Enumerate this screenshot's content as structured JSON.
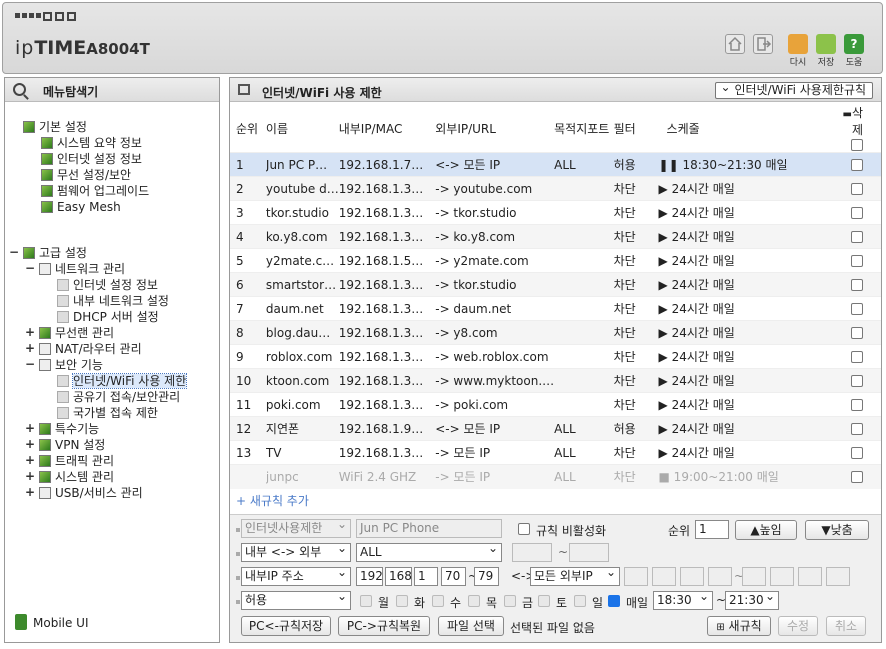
{
  "brand": {
    "logo_prefix": "ip",
    "logo_bold": "TIME",
    "model": "A8004T"
  },
  "top_actions": [
    {
      "label": "다시",
      "color": "#e8a33a",
      "icon": "logout-icon"
    },
    {
      "label": "저장",
      "color": "#8cc24a",
      "icon": "save-icon"
    },
    {
      "label": "도움",
      "color": "#3a9a3a",
      "icon": "help-icon"
    }
  ],
  "sidebar": {
    "title": "메뉴탐색기",
    "basic": {
      "label": "기본 설정",
      "items": [
        "시스템 요약 정보",
        "인터넷 설정 정보",
        "무선 설정/보안",
        "펌웨어 업그레이드",
        "Easy Mesh"
      ]
    },
    "advanced": {
      "label": "고급 설정",
      "network": "네트워크 관리",
      "network_items": [
        "인터넷 설정 정보",
        "내부 네트워크 설정",
        "DHCP 서버 설정"
      ],
      "wireless": "무선랜 관리",
      "nat": "NAT/라우터 관리",
      "security": "보안 기능",
      "security_items": [
        "인터넷/WiFi 사용 제한",
        "공유기 접속/보안관리",
        "국가별 접속 제한"
      ],
      "special": "특수기능",
      "vpn": "VPN 설정",
      "traffic": "트래픽 관리",
      "system": "시스템 관리",
      "usb": "USB/서비스 관리"
    },
    "mobile": "Mobile UI"
  },
  "main": {
    "title": "인터넷/WiFi 사용 제한",
    "dropdown": "인터넷/WiFi 사용제한규칙",
    "headers": [
      "순위",
      "이름",
      "내부IP/MAC",
      "외부IP/URL",
      "목적지포트",
      "필터",
      "스케줄",
      "삭제"
    ],
    "rows": [
      [
        "1",
        "Jun PC P…",
        "192.168.1.7…",
        "<-> 모든 IP",
        "ALL",
        "허용",
        "❚❚ 18:30~21:30 매일"
      ],
      [
        "2",
        "youtube d…",
        "192.168.1.3…",
        "-> youtube.com",
        "",
        "차단",
        "▶ 24시간 매일"
      ],
      [
        "3",
        "tkor.studio",
        "192.168.1.3…",
        "-> tkor.studio",
        "",
        "차단",
        "▶ 24시간 매일"
      ],
      [
        "4",
        "ko.y8.com",
        "192.168.1.3…",
        "-> ko.y8.com",
        "",
        "차단",
        "▶ 24시간 매일"
      ],
      [
        "5",
        "y2mate.c…",
        "192.168.1.5…",
        "-> y2mate.com",
        "",
        "차단",
        "▶ 24시간 매일"
      ],
      [
        "6",
        "smartstor…",
        "192.168.1.3…",
        "-> tkor.studio",
        "",
        "차단",
        "▶ 24시간 매일"
      ],
      [
        "7",
        "daum.net",
        "192.168.1.3…",
        "-> daum.net",
        "",
        "차단",
        "▶ 24시간 매일"
      ],
      [
        "8",
        "blog.dau…",
        "192.168.1.3…",
        "-> y8.com",
        "",
        "차단",
        "▶ 24시간 매일"
      ],
      [
        "9",
        "roblox.com",
        "192.168.1.3…",
        "-> web.roblox.com",
        "",
        "차단",
        "▶ 24시간 매일"
      ],
      [
        "10",
        "ktoon.com",
        "192.168.1.3…",
        "-> www.myktoon.…",
        "",
        "차단",
        "▶ 24시간 매일"
      ],
      [
        "11",
        "poki.com",
        "192.168.1.3…",
        "-> poki.com",
        "",
        "차단",
        "▶ 24시간 매일"
      ],
      [
        "12",
        "지연폰",
        "192.168.1.9…",
        "<-> 모든 IP",
        "ALL",
        "허용",
        "▶ 24시간 매일"
      ],
      [
        "13",
        "TV",
        "192.168.1.3…",
        "-> 모든 IP",
        "ALL",
        "차단",
        "▶ 24시간 매일"
      ],
      [
        "",
        "junpc",
        "WiFi 2.4 GHZ",
        "-> 모든 IP",
        "ALL",
        "차단",
        "■ 19:00~21:00 매일"
      ]
    ],
    "add_rule": "+ 새규칙 추가"
  },
  "form": {
    "rule_type": "인터넷사용제한",
    "rule_name": "Jun PC Phone",
    "disable_label": "규칙 비활성화",
    "priority_label": "순위",
    "priority": "1",
    "up": "▲높임",
    "down": "▼낮춤",
    "direction": "내부 <-> 외부",
    "port": "ALL",
    "tilde": "~",
    "ip_type": "내부IP 주소",
    "ip": [
      "192",
      "168",
      "1",
      "70",
      "79"
    ],
    "ext": "모든 외부IP",
    "arrow": "<->",
    "action": "허용",
    "days": [
      "월",
      "화",
      "수",
      "목",
      "금",
      "토",
      "일",
      "매일"
    ],
    "start": "18:30",
    "end": "21:30",
    "pc_save": "PC<-규칙저장",
    "pc_restore": "PC->규칙복원",
    "file_select": "파일 선택",
    "file_none": "선택된 파일 없음",
    "new_rule": "새규칙",
    "edit": "수정",
    "cancel": "취소"
  }
}
